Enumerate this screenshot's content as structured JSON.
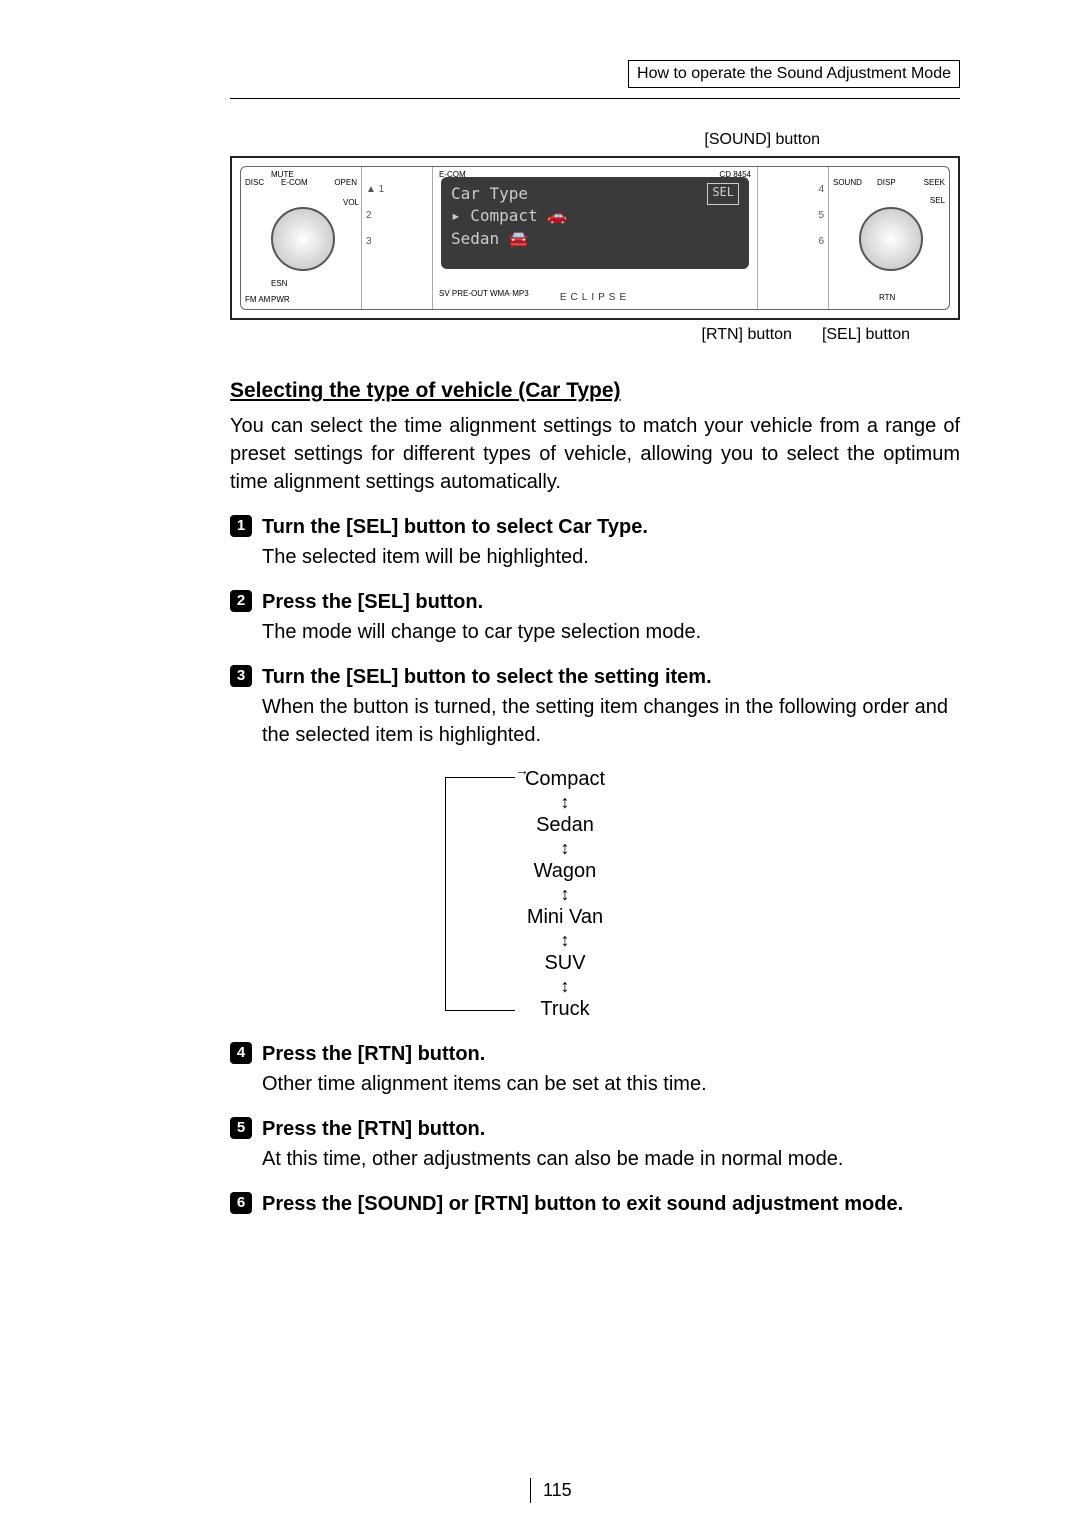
{
  "header": {
    "breadcrumb": "How to operate the Sound Adjustment Mode"
  },
  "callouts": {
    "sound": "[SOUND] button",
    "rtn": "[RTN] button",
    "sel": "[SEL] button"
  },
  "device": {
    "model": "CD 8454",
    "brand": "ECLIPSE",
    "logo": "E-COM",
    "screen": {
      "line1_left": "Car Type",
      "line1_right": "SEL",
      "line2": "▸ Compact  🚗",
      "line3": "  Sedan    🚘"
    },
    "leftLabels": {
      "mute": "MUTE",
      "disc": "DISC",
      "ecom": "E-COM",
      "open": "OPEN",
      "vol": "VOL",
      "esn": "ESN",
      "fmam": "FM AM",
      "pwr": "PWR"
    },
    "rightLabels": {
      "sound": "SOUND",
      "disp": "DISP",
      "seek": "SEEK",
      "sel": "SEL",
      "rtn": "RTN"
    },
    "presetLeft": [
      "▲  1",
      "2",
      "3"
    ],
    "presetRight": [
      "4",
      "5",
      "6"
    ],
    "badges": "SV PRE-OUT   WMA·MP3"
  },
  "section": {
    "title": "Selecting the type of vehicle (Car Type)",
    "intro": "You can select the time alignment settings to match your vehicle from a range of preset settings for different types of vehicle, allowing you to select the optimum time alignment settings automatically."
  },
  "steps": [
    {
      "n": "1",
      "title": "Turn the [SEL] button to select Car Type.",
      "body": "The selected item will be highlighted."
    },
    {
      "n": "2",
      "title": "Press the [SEL] button.",
      "body": "The mode will change to car type selection mode."
    },
    {
      "n": "3",
      "title": "Turn the [SEL] button to select the setting item.",
      "body": "When the button is turned, the setting item changes in the following order and the selected item is highlighted."
    },
    {
      "n": "4",
      "title": "Press the [RTN] button.",
      "body": "Other time alignment items can be set at this time."
    },
    {
      "n": "5",
      "title": "Press the [RTN] button.",
      "body": "At this time, other adjustments can also be made in normal mode."
    },
    {
      "n": "6",
      "title": "Press the [SOUND] or [RTN] button to exit sound adjustment mode.",
      "body": ""
    }
  ],
  "cycle": [
    "Compact",
    "Sedan",
    "Wagon",
    "Mini Van",
    "SUV",
    "Truck"
  ],
  "pagenum": "115"
}
